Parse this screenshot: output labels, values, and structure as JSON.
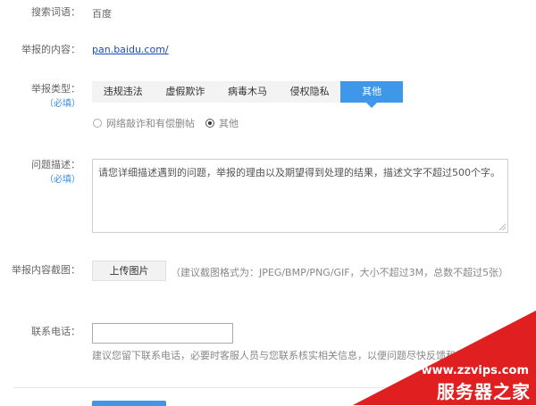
{
  "search_term": {
    "label": "搜索词语：",
    "value": "百度"
  },
  "report_content": {
    "label": "举报的内容：",
    "link": "pan.baidu.com/"
  },
  "report_type": {
    "label": "举报类型：",
    "required": "（必填）",
    "tabs": [
      {
        "label": "违规违法"
      },
      {
        "label": "虚假欺诈"
      },
      {
        "label": "病毒木马"
      },
      {
        "label": "侵权隐私"
      },
      {
        "label": "其他"
      }
    ],
    "active_tab": "其他",
    "sub_options": [
      {
        "label": "网络敲诈和有偿删帖",
        "selected": false
      },
      {
        "label": "其他",
        "selected": true
      }
    ]
  },
  "description": {
    "label": "问题描述：",
    "required": "（必填）",
    "placeholder": "请您详细描述遇到的问题，举报的理由以及期望得到处理的结果，描述文字不超过500个字。"
  },
  "screenshot": {
    "label": "举报内容截图：",
    "button": "上传图片",
    "hint": "（建议截图格式为：JPEG/BMP/PNG/GIF，大小不超过3M，总数不超过5张）"
  },
  "contact": {
    "label": "联系电话：",
    "value": "",
    "hint": "建议您留下联系电话，必要时客服人员与您联系核实相关信息，以便问题尽快反馈和处理。"
  },
  "watermark": {
    "url": "www.zzvips.com",
    "text": "服务器之家",
    "color": "#e02020"
  },
  "colors": {
    "accent": "#3e97e9",
    "link": "#1a4bb8",
    "required": "#3a8ee6"
  }
}
